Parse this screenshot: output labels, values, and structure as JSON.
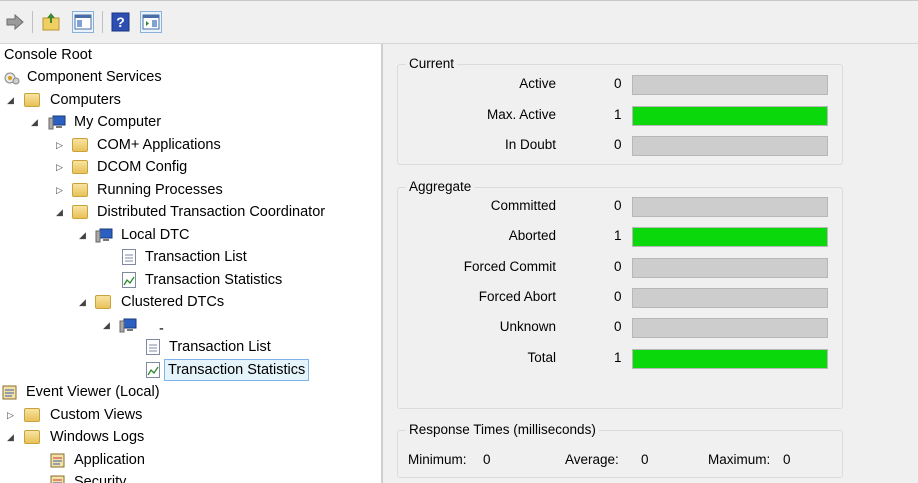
{
  "toolbar": {
    "buttons": [
      "forward-arrow-icon",
      "up-folder-icon",
      "show-hide-console-tree-icon",
      "help-icon",
      "show-hide-action-pane-icon"
    ]
  },
  "tree": {
    "items": [
      {
        "label": "Console Root",
        "icon": "none",
        "twisty": ""
      },
      {
        "label": "Component Services",
        "icon": "component-services-icon",
        "twisty": ""
      },
      {
        "label": "Computers",
        "icon": "folder-icon",
        "twisty": "◢"
      },
      {
        "label": "My Computer",
        "icon": "computer-icon",
        "twisty": "◢"
      },
      {
        "label": "COM+ Applications",
        "icon": "folder-icon",
        "twisty": "▷"
      },
      {
        "label": "DCOM Config",
        "icon": "folder-icon",
        "twisty": "▷"
      },
      {
        "label": "Running Processes",
        "icon": "folder-icon",
        "twisty": "▷"
      },
      {
        "label": "Distributed Transaction Coordinator",
        "icon": "folder-icon",
        "twisty": "◢"
      },
      {
        "label": "Local DTC",
        "icon": "computer-icon",
        "twisty": "◢"
      },
      {
        "label": "Transaction List",
        "icon": "list-icon",
        "twisty": ""
      },
      {
        "label": "Transaction Statistics",
        "icon": "statistics-icon",
        "twisty": ""
      },
      {
        "label": "Clustered DTCs",
        "icon": "folder-icon",
        "twisty": "◢"
      },
      {
        "label": "-",
        "icon": "computer-icon",
        "twisty": "◢"
      },
      {
        "label": "Transaction List",
        "icon": "list-icon",
        "twisty": ""
      },
      {
        "label": "Transaction Statistics",
        "icon": "statistics-icon",
        "twisty": ""
      },
      {
        "label": "Event Viewer (Local)",
        "icon": "event-viewer-icon",
        "twisty": ""
      },
      {
        "label": "Custom Views",
        "icon": "folder-icon",
        "twisty": "▷"
      },
      {
        "label": "Windows Logs",
        "icon": "folder-icon",
        "twisty": "◢"
      },
      {
        "label": "Application",
        "icon": "log-icon",
        "twisty": ""
      },
      {
        "label": "Security",
        "icon": "log-icon",
        "twisty": ""
      }
    ]
  },
  "current": {
    "title": "Current",
    "rows": [
      {
        "label": "Active",
        "value": "0",
        "level": 0
      },
      {
        "label": "Max. Active",
        "value": "1",
        "level": 1
      },
      {
        "label": "In Doubt",
        "value": "0",
        "level": 0
      }
    ]
  },
  "aggregate": {
    "title": "Aggregate",
    "rows": [
      {
        "label": "Committed",
        "value": "0",
        "level": 0
      },
      {
        "label": "Aborted",
        "value": "1",
        "level": 1
      },
      {
        "label": "Forced Commit",
        "value": "0",
        "level": 0
      },
      {
        "label": "Forced Abort",
        "value": "0",
        "level": 0
      },
      {
        "label": "Unknown",
        "value": "0",
        "level": 0
      },
      {
        "label": "Total",
        "value": "1",
        "level": 1
      }
    ]
  },
  "response": {
    "title": "Response Times (milliseconds)",
    "minimum_label": "Minimum:",
    "minimum_value": "0",
    "average_label": "Average:",
    "average_value": "0",
    "maximum_label": "Maximum:",
    "maximum_value": "0"
  },
  "colors": {
    "bar_fill": "#0ad80a",
    "bar_empty": "#cdcdcd",
    "selection": "#e5f3fb"
  }
}
